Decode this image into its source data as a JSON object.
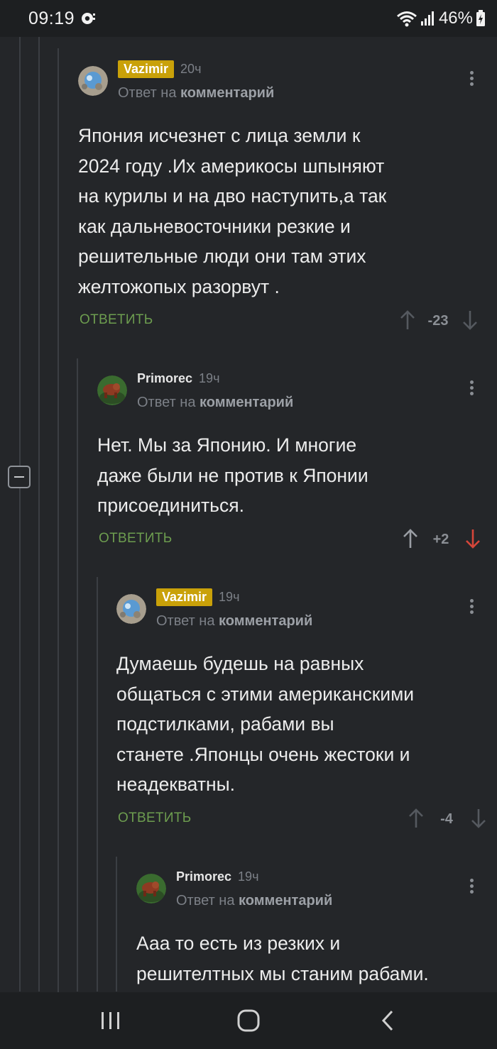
{
  "status": {
    "time": "09:19",
    "battery": "46%"
  },
  "comments": [
    {
      "author": "Vazimir",
      "author_badge": true,
      "time": "20ч",
      "reply_to_label": "Ответ на",
      "reply_to_link": "комментарий",
      "lines": [
        "Япония исчезнет с лица земли к",
        "2024 году .Их америкосы шпыняют",
        "на курилы и на дво наступить,а так",
        "как дальневосточники резкие и",
        "решительные люди они там этих",
        "желтожопых разорвут ."
      ],
      "reply_label": "ОТВЕТИТЬ",
      "score": "-23"
    },
    {
      "author": "Primorec",
      "author_badge": false,
      "time": "19ч",
      "reply_to_label": "Ответ на",
      "reply_to_link": "комментарий",
      "lines": [
        "Нет. Мы за Японию. И многие",
        "даже были не против к Японии",
        "присоединиться."
      ],
      "reply_label": "ОТВЕТИТЬ",
      "score": "+2"
    },
    {
      "author": "Vazimir",
      "author_badge": true,
      "time": "19ч",
      "reply_to_label": "Ответ на",
      "reply_to_link": "комментарий",
      "lines": [
        "Думаешь будешь на равных",
        "общаться с этими американскими",
        "подстилками, рабами вы",
        "станете .Японцы очень жестоки и",
        "неадекватны."
      ],
      "reply_label": "ОТВЕТИТЬ",
      "score": "-4"
    },
    {
      "author": "Primorec",
      "author_badge": false,
      "time": "19ч",
      "reply_to_label": "Ответ на",
      "reply_to_link": "комментарий",
      "lines": [
        "Ааа то есть из резких и",
        "решителтных мы станим рабами."
      ]
    }
  ],
  "colors": {
    "badge": "#c9a109",
    "reply": "#6d9d4f",
    "downvote_active": "#d5463a"
  },
  "icons": [
    "wifi-icon",
    "signal-icon",
    "battery-icon",
    "more-vert-icon",
    "arrow-up-icon",
    "arrow-down-icon",
    "recent-apps-icon",
    "home-icon",
    "back-icon"
  ]
}
